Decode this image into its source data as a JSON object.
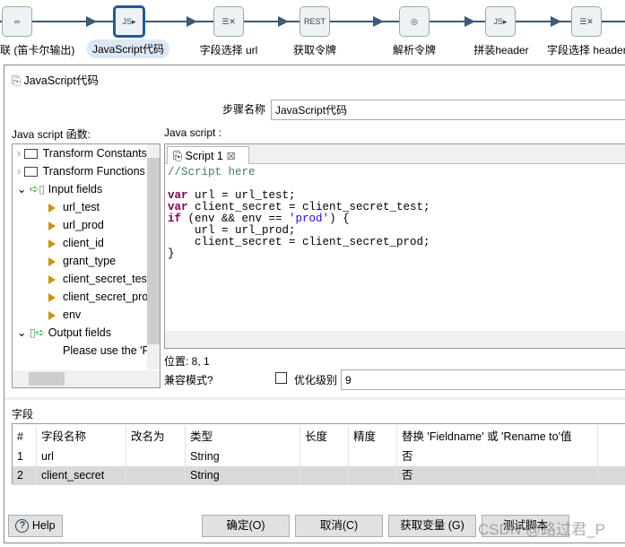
{
  "canvas": {
    "steps": [
      {
        "label": "关联 (笛卡尔输出)",
        "icon": "join-icon"
      },
      {
        "label": "JavaScript代码",
        "icon": "javascript-icon",
        "selected": true
      },
      {
        "label": "字段选择 url",
        "icon": "select-values-icon"
      },
      {
        "label": "获取令牌",
        "icon": "rest-client-icon"
      },
      {
        "label": "解析令牌",
        "icon": "json-input-icon"
      },
      {
        "label": "拼装header",
        "icon": "javascript-icon"
      },
      {
        "label": "字段选择 header",
        "icon": "select-values-icon"
      }
    ]
  },
  "dialog": {
    "title": "JavaScript代码",
    "step_name_label": "步骤名称",
    "step_name_value": "JavaScript代码",
    "functions_label": "Java script 函数:",
    "script_label": "Java script :",
    "tree": [
      "Transform Constants",
      "Transform Functions",
      "Input fields",
      "url_test",
      "url_prod",
      "client_id",
      "grant_type",
      "client_secret_test",
      "client_secret_prod",
      "env",
      "Output fields",
      "Please use the 'Fields' table"
    ],
    "script_tab": "Script 1",
    "code": {
      "comment": "//Script here",
      "var": "var",
      "if": "if",
      "l1": " url = url_test;",
      "l2": " client_secret = client_secret_test;",
      "l3a": " (env && env == ",
      "l3s": "'prod'",
      "l3b": ") {",
      "l4": "    url = url_prod;",
      "l5": "    client_secret = client_secret_prod;",
      "l6": "}"
    },
    "position": "位置: 8, 1",
    "compat_label": "兼容模式?",
    "optimize_label": "优化级别",
    "optimize_value": "9",
    "fields_label": "字段",
    "columns": [
      "#",
      "字段名称",
      "改名为",
      "类型",
      "长度",
      "精度",
      "替换 'Fieldname' 或 'Rename to'值"
    ],
    "rows": [
      [
        "1",
        "url",
        "",
        "String",
        "",
        "",
        "否"
      ],
      [
        "2",
        "client_secret",
        "",
        "String",
        "",
        "",
        "否"
      ]
    ],
    "buttons": {
      "help": "Help",
      "ok": "确定(O)",
      "cancel": "取消(C)",
      "get_vars": "获取变量 (G)",
      "test": "测试脚本"
    },
    "watermark": "CSDN @路过君_P"
  }
}
